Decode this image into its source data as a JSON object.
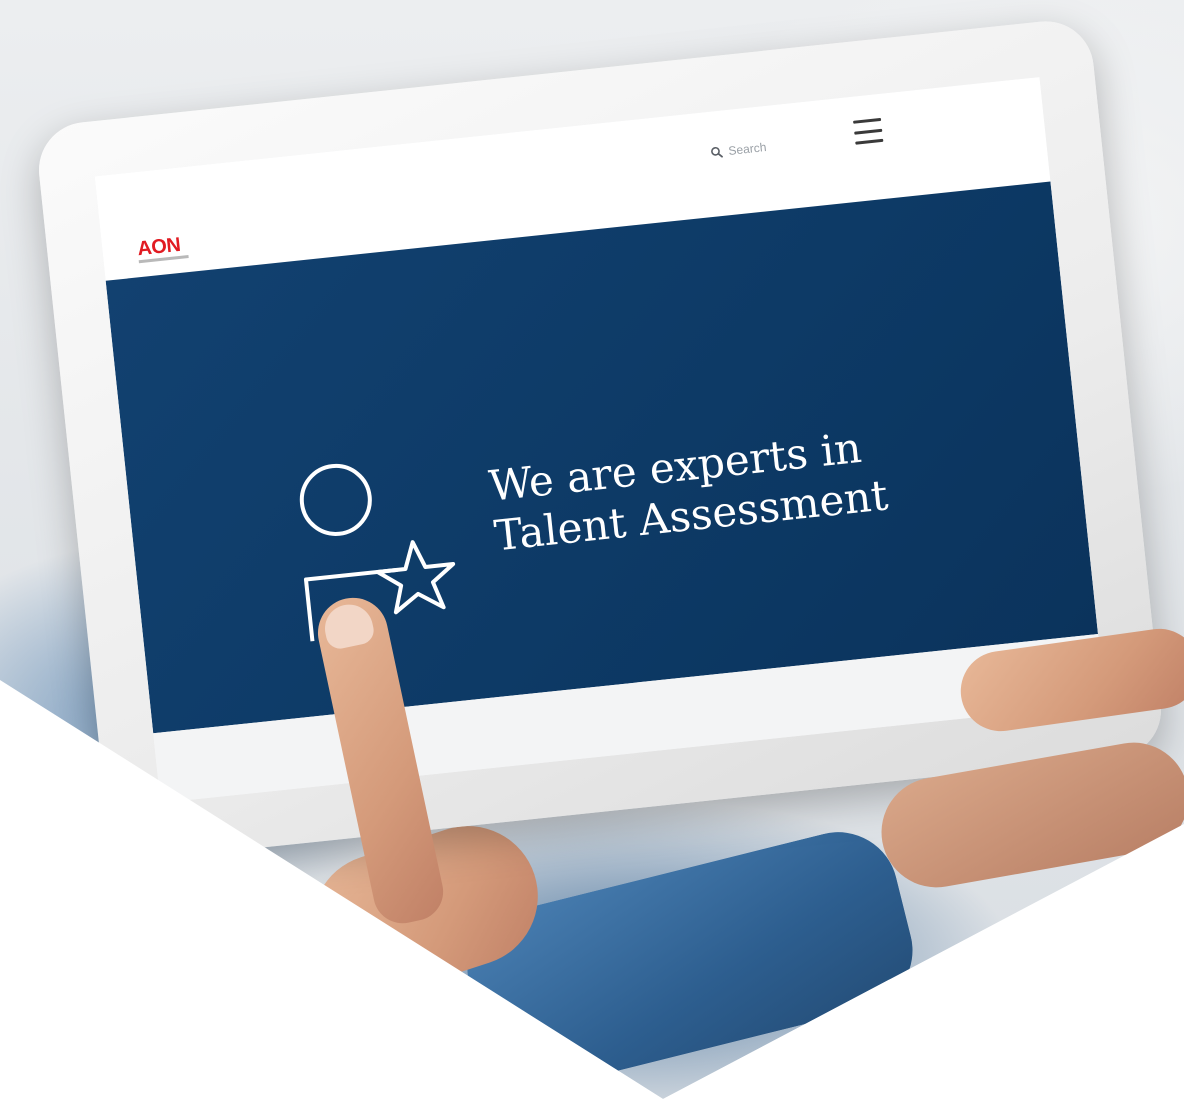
{
  "screen": {
    "logo": {
      "text": "AON",
      "icon": "aon-logo",
      "color": "#e11b22"
    },
    "search": {
      "icon": "search-icon",
      "placeholder": "Search"
    },
    "menu": {
      "icon": "hamburger-menu-icon"
    },
    "hero": {
      "icon": "person-star-icon",
      "heading_line1": "We are experts in",
      "heading_line2": "Talent Assessment",
      "background": "#0f3c6a"
    }
  }
}
